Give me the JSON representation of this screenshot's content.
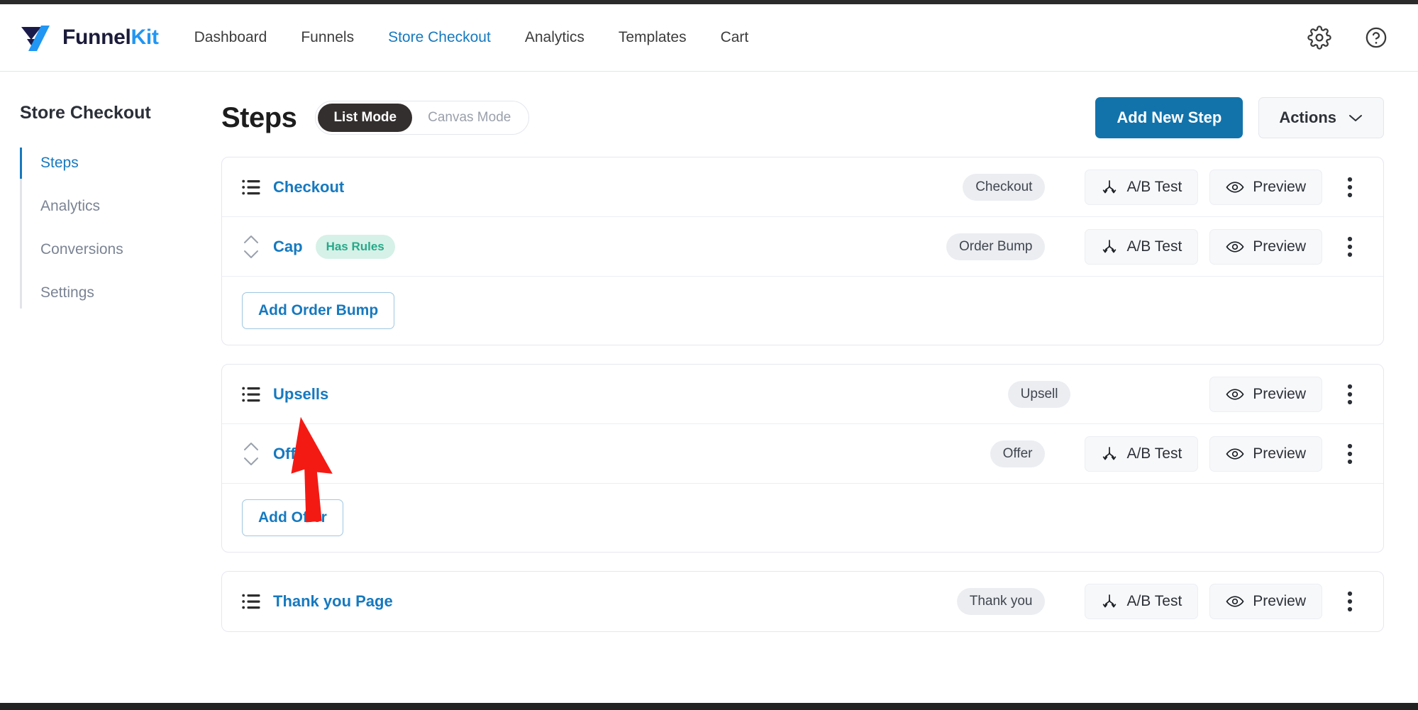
{
  "brand": {
    "name_part1": "Funnel",
    "name_part2": "Kit",
    "logo_icon": "funnelkit-logo-icon"
  },
  "topnav": {
    "items": [
      {
        "label": "Dashboard",
        "active": false
      },
      {
        "label": "Funnels",
        "active": false
      },
      {
        "label": "Store Checkout",
        "active": true
      },
      {
        "label": "Analytics",
        "active": false
      },
      {
        "label": "Templates",
        "active": false
      },
      {
        "label": "Cart",
        "active": false
      }
    ],
    "settings_icon": "gear-icon",
    "help_icon": "help-circle-icon"
  },
  "sidebar": {
    "title": "Store Checkout",
    "items": [
      {
        "label": "Steps",
        "active": true
      },
      {
        "label": "Analytics",
        "active": false
      },
      {
        "label": "Conversions",
        "active": false
      },
      {
        "label": "Settings",
        "active": false
      }
    ]
  },
  "main": {
    "title": "Steps",
    "mode_toggle": {
      "list": "List Mode",
      "canvas": "Canvas Mode",
      "selected": "List Mode"
    },
    "add_new_step": "Add New Step",
    "actions": "Actions"
  },
  "labels": {
    "ab_test": "A/B Test",
    "preview": "Preview",
    "ab_test_icon": "ab-split-icon",
    "preview_icon": "eye-icon",
    "kebab_icon": "more-vertical-icon",
    "list_icon": "list-icon",
    "sorter_icon": "sort-updown-icon",
    "chevron_down_icon": "chevron-down-icon"
  },
  "cards": [
    {
      "id": "checkout-card",
      "rows": [
        {
          "name": "Checkout",
          "icon": "list-icon",
          "type_badge": "Checkout",
          "rules_badge": null,
          "has_ab_test": true,
          "has_preview": true
        },
        {
          "name": "Cap",
          "icon": "sort-updown-icon",
          "type_badge": "Order Bump",
          "rules_badge": "Has Rules",
          "has_ab_test": true,
          "has_preview": true
        }
      ],
      "add_button": "Add Order Bump"
    },
    {
      "id": "upsells-card",
      "rows": [
        {
          "name": "Upsells",
          "icon": "list-icon",
          "type_badge": "Upsell",
          "rules_badge": null,
          "has_ab_test": false,
          "has_preview": true
        },
        {
          "name": "Offer",
          "icon": "sort-updown-icon",
          "type_badge": "Offer",
          "rules_badge": null,
          "has_ab_test": true,
          "has_preview": true
        }
      ],
      "add_button": "Add Offer"
    },
    {
      "id": "thankyou-card",
      "rows": [
        {
          "name": "Thank you Page",
          "icon": "list-icon",
          "type_badge": "Thank you",
          "rules_badge": null,
          "has_ab_test": true,
          "has_preview": true
        }
      ],
      "add_button": null
    }
  ],
  "annotation": {
    "cursor_icon": "red-arrow-cursor",
    "color": "#f41a14"
  },
  "colors": {
    "accent_blue": "#1679bf",
    "primary_button": "#1273ab",
    "badge_green_bg": "#d6f1e7",
    "badge_green_text": "#27a98a",
    "badge_gray_bg": "#ebedf1",
    "toggle_active_bg": "#332f2e"
  }
}
